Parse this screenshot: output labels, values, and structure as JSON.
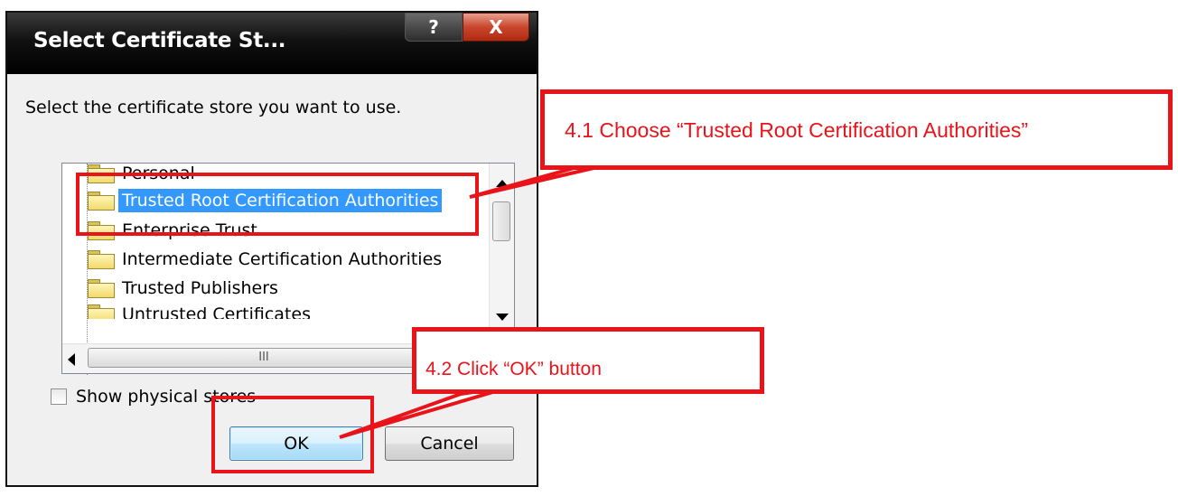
{
  "dialog": {
    "title": "Select Certificate St...",
    "help_glyph": "?",
    "close_glyph": "X",
    "instruction": "Select the certificate store you want to use.",
    "tree_items": [
      {
        "label": "Personal",
        "selected": false
      },
      {
        "label": "Trusted Root Certification Authorities",
        "selected": true
      },
      {
        "label": "Enterprise Trust",
        "selected": false
      },
      {
        "label": "Intermediate Certification Authorities",
        "selected": false
      },
      {
        "label": "Trusted Publishers",
        "selected": false
      },
      {
        "label": "Untrusted Certificates",
        "selected": false
      }
    ],
    "hscroll_grip": "III",
    "checkbox_label": "Show physical stores",
    "ok_label": "OK",
    "cancel_label": "Cancel"
  },
  "annotations": {
    "step1": "4.1 Choose “Trusted Root Certification Authorities”",
    "step2": "4.2 Click “OK” button",
    "color": "#e8141a"
  }
}
